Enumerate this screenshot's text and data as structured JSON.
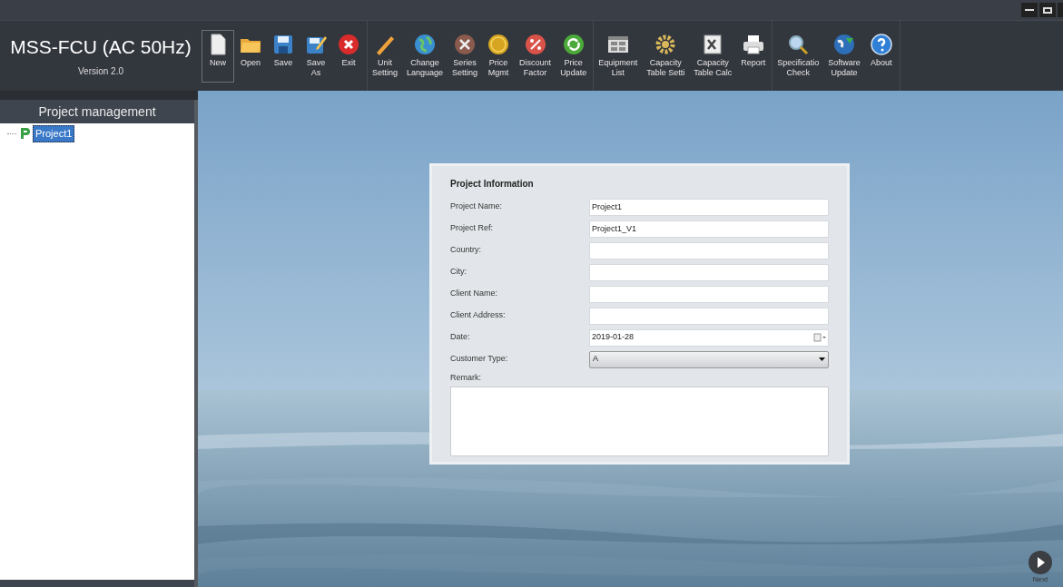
{
  "app": {
    "title": "MSS-FCU (AC 50Hz)",
    "version": "Version 2.0"
  },
  "toolbar": {
    "groups": [
      [
        {
          "label": "New",
          "selected": true
        },
        {
          "label": "Open",
          "selected": false
        },
        {
          "label": "Save",
          "selected": false
        },
        {
          "label": "Save\nAs",
          "selected": false
        },
        {
          "label": "Exit",
          "selected": false
        }
      ],
      [
        {
          "label": "Unit\nSetting",
          "selected": false
        },
        {
          "label": "Change\nLanguage",
          "selected": false
        },
        {
          "label": "Series\nSetting",
          "selected": false
        },
        {
          "label": "Price\nMgmt",
          "selected": false
        },
        {
          "label": "Discount\nFactor",
          "selected": false
        },
        {
          "label": "Price\nUpdate",
          "selected": false
        }
      ],
      [
        {
          "label": "Equipment\nList",
          "selected": false
        },
        {
          "label": "Capacity\nTable Setti",
          "selected": false
        },
        {
          "label": "Capacity\nTable Calc",
          "selected": false
        },
        {
          "label": "Report",
          "selected": false
        }
      ],
      [
        {
          "label": "Specificatio\nCheck",
          "selected": false
        },
        {
          "label": "Software\nUpdate",
          "selected": false
        },
        {
          "label": "About",
          "selected": false
        }
      ]
    ]
  },
  "sidebar": {
    "title": "Project management",
    "tree": [
      {
        "label": "Project1",
        "selected": true
      }
    ]
  },
  "form": {
    "title": "Project Information",
    "fields": [
      {
        "kind": "text",
        "label": "Project Name:",
        "value": "Project1"
      },
      {
        "kind": "text",
        "label": "Project Ref:",
        "value": "Project1_V1"
      },
      {
        "kind": "text",
        "label": "Country:"
      },
      {
        "kind": "text",
        "label": "City:"
      },
      {
        "kind": "text",
        "label": "Client Name:"
      },
      {
        "kind": "text",
        "label": "Client Address:"
      },
      {
        "kind": "date",
        "label": "Date:",
        "value": "2019-01-28"
      },
      {
        "kind": "select",
        "label": "Customer Type:",
        "value": "A"
      }
    ],
    "remark_label": "Remark:"
  },
  "next_button": {
    "label": "Next"
  }
}
